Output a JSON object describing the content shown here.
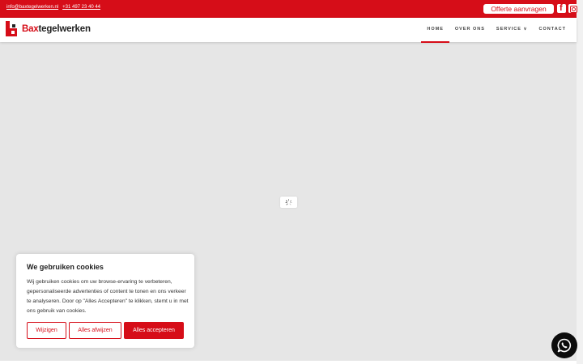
{
  "topbar": {
    "email": "info@baxtegelwerken.nl",
    "phone": "+31 497 23 40 44",
    "quote_button": "Offerte aanvragen",
    "social": [
      "facebook-icon",
      "instagram-icon"
    ],
    "color": "#d60d18"
  },
  "header": {
    "logo_prefix": "Bax",
    "logo_suffix": "tegelwerken",
    "nav": [
      {
        "label": "HOME",
        "active": true
      },
      {
        "label": "OVER ONS",
        "active": false
      },
      {
        "label": "SERVICE ∨",
        "active": false
      },
      {
        "label": "CONTACT",
        "active": false
      }
    ]
  },
  "cookie": {
    "title": "We gebruiken cookies",
    "text": "Wij gebruiken cookies om uw browse-ervaring te verbeteren, gepersonaliseerde advertenties of content te tonen en ons verkeer te analyseren. Door op \"Alles Accepteren\" te klikken, stemt u in met ons gebruik van cookies.",
    "buttons": {
      "customize": "Wijzigen",
      "reject": "Alles afwijzen",
      "accept": "Alles accepteren"
    }
  },
  "icons": {
    "loader": "loading-spinner-icon",
    "chat": "whatsapp-icon"
  }
}
